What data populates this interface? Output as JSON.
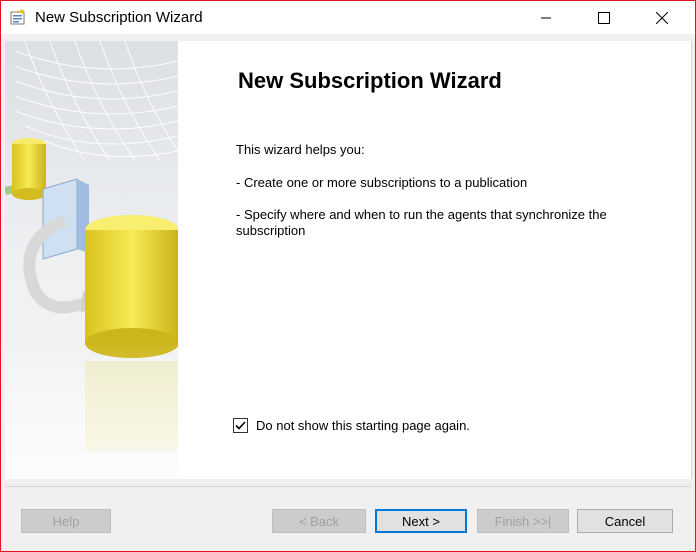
{
  "window": {
    "title": "New Subscription Wizard",
    "icon": "wizard-app-icon",
    "accent_border": "#e81123"
  },
  "main": {
    "heading": "New Subscription Wizard",
    "intro": "This wizard helps you:",
    "bullets": [
      " - Create one or more subscriptions to a publication",
      " - Specify where and when to run the agents that synchronize the subscription"
    ],
    "checkbox": {
      "label": "Do not show this starting page again.",
      "checked": true
    }
  },
  "buttons": {
    "help": "Help",
    "back": "< Back",
    "next": "Next >",
    "finish": "Finish >>|",
    "cancel": "Cancel"
  },
  "colors": {
    "default_button_border": "#0078d7",
    "art_cylinder": "#f2e24a"
  }
}
